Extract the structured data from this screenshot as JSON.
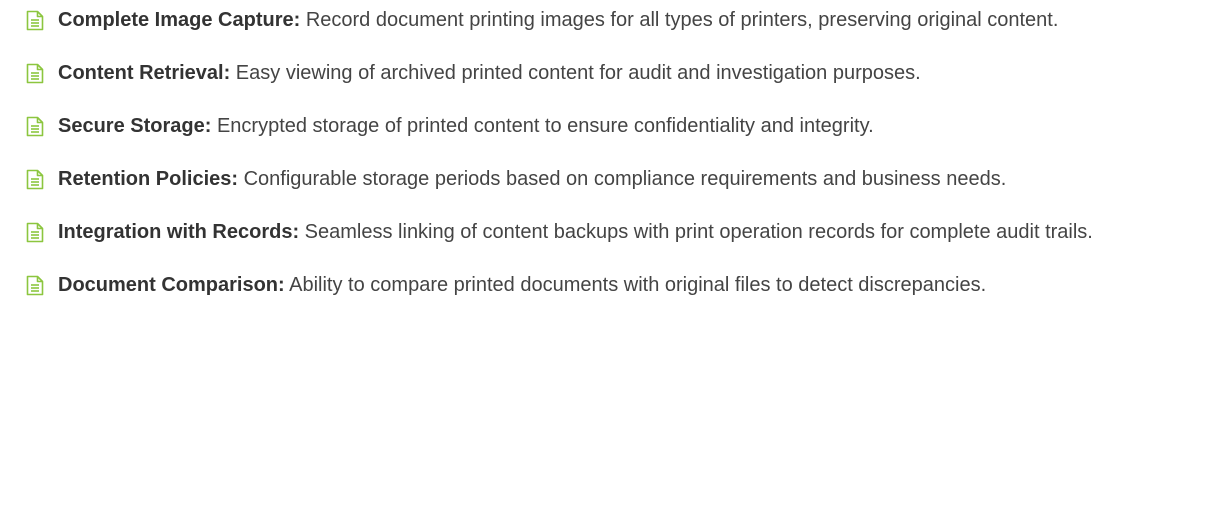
{
  "icon": {
    "name": "document-icon",
    "color": "#8cc63f"
  },
  "features": [
    {
      "title": "Complete Image Capture:",
      "description": " Record document printing images for all types of printers, preserving original content."
    },
    {
      "title": "Content Retrieval:",
      "description": " Easy viewing of archived printed content for audit and investigation purposes."
    },
    {
      "title": "Secure Storage:",
      "description": " Encrypted storage of printed content to ensure confidentiality and integrity."
    },
    {
      "title": "Retention Policies:",
      "description": " Configurable storage periods based on compliance requirements and business needs."
    },
    {
      "title": "Integration with Records:",
      "description": " Seamless linking of content backups with print operation records for complete audit trails."
    },
    {
      "title": "Document Comparison:",
      "description": " Ability to compare printed documents with original files to detect discrepancies."
    }
  ]
}
